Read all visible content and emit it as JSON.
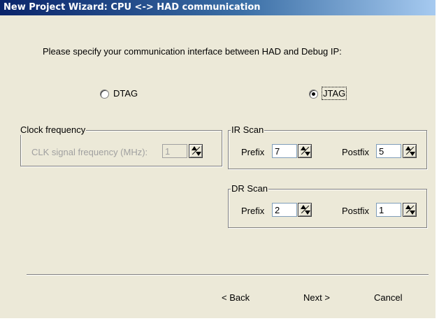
{
  "window": {
    "title": "New Project Wizard: CPU <-> HAD communication"
  },
  "instruction": "Please specify your communication interface between HAD and Debug IP:",
  "interface": {
    "options": [
      {
        "label": "DTAG",
        "selected": false
      },
      {
        "label": "JTAG",
        "selected": true
      }
    ]
  },
  "clock": {
    "legend": "Clock frequency",
    "label": "CLK signal frequency (MHz):",
    "value": "1"
  },
  "ir_scan": {
    "legend": "IR Scan",
    "prefix_label": "Prefix",
    "prefix_value": "7",
    "postfix_label": "Postfix",
    "postfix_value": "5"
  },
  "dr_scan": {
    "legend": "DR Scan",
    "prefix_label": "Prefix",
    "prefix_value": "2",
    "postfix_label": "Postfix",
    "postfix_value": "1"
  },
  "buttons": {
    "back": "< Back",
    "next": "Next >",
    "cancel": "Cancel"
  },
  "icons": {
    "spinner": "spin-arrows-icon"
  }
}
